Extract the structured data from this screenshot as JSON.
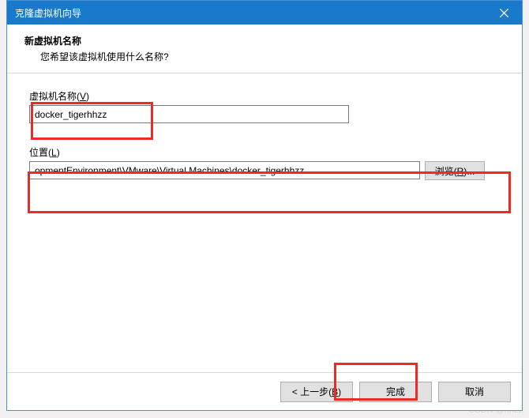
{
  "titlebar": {
    "title": "克隆虚拟机向导"
  },
  "header": {
    "title": "新虚拟机名称",
    "subtitle": "您希望该虚拟机使用什么名称?"
  },
  "fields": {
    "name": {
      "label_prefix": "虚拟机名称(",
      "label_mnemonic": "V",
      "label_suffix": ")",
      "value": "docker_tigerhhzz"
    },
    "location": {
      "label_prefix": "位置(",
      "label_mnemonic": "L",
      "label_suffix": ")",
      "value": "opmentEnvironment\\VMware\\Virtual Machines\\docker_tigerhhzz",
      "browse_prefix": "浏览(",
      "browse_mnemonic": "R",
      "browse_suffix": ")..."
    }
  },
  "buttons": {
    "back_prefix": "< 上一步(",
    "back_mnemonic": "B",
    "back_suffix": ")",
    "finish": "完成",
    "cancel": "取消"
  },
  "watermark": "CSDN @hhzz"
}
